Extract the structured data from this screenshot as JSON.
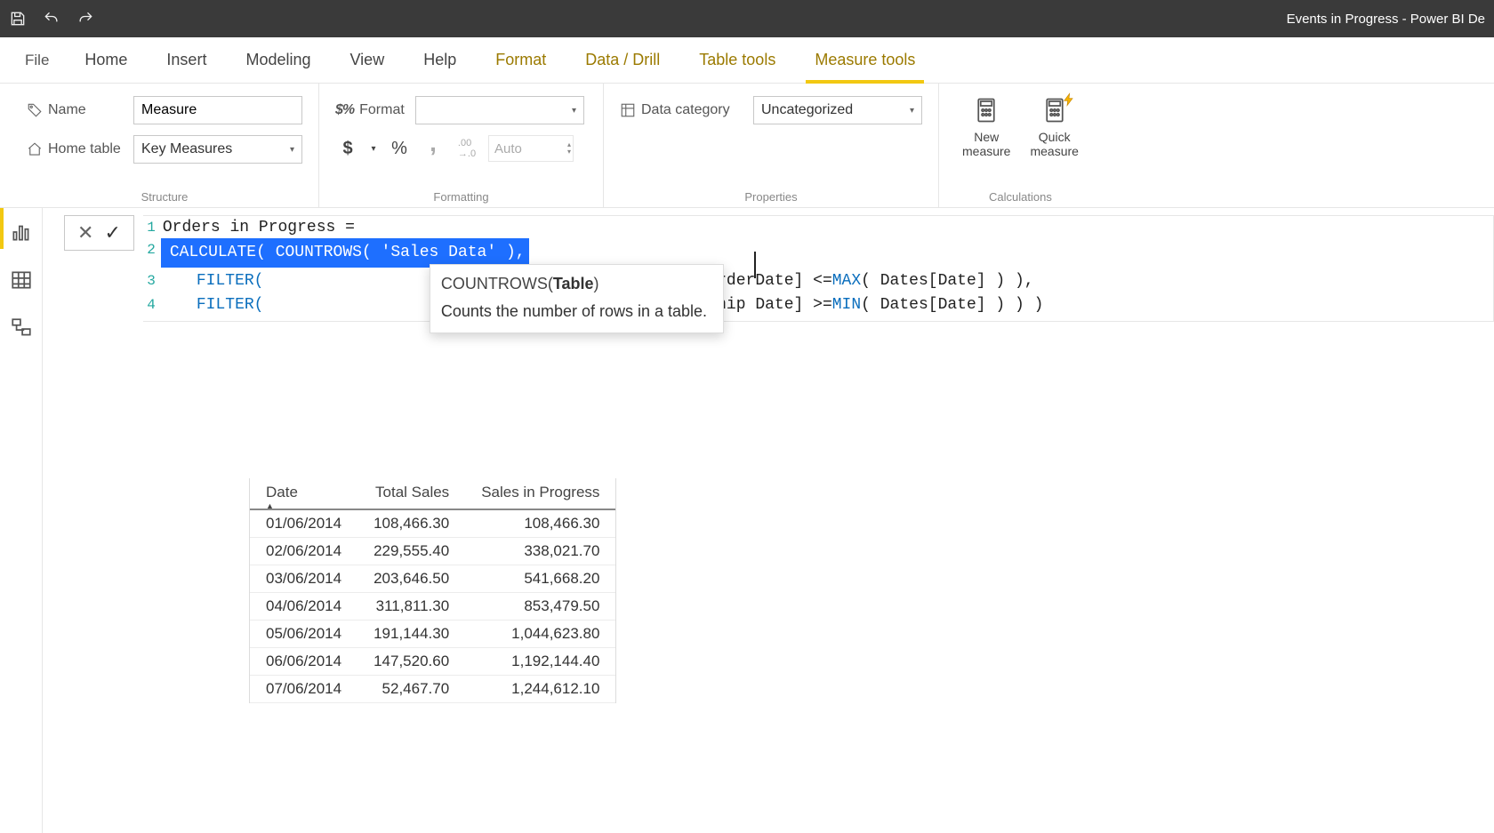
{
  "window": {
    "title": "Events in Progress - Power BI De"
  },
  "ribbon_tabs": {
    "file": "File",
    "tabs": [
      "Home",
      "Insert",
      "Modeling",
      "View",
      "Help",
      "Format",
      "Data / Drill",
      "Table tools",
      "Measure tools"
    ],
    "contextual_from_index": 5,
    "active_index": 8
  },
  "structure_group": {
    "title": "Structure",
    "name_label": "Name",
    "name_value": "Measure",
    "home_table_label": "Home table",
    "home_table_value": "Key Measures"
  },
  "formatting_group": {
    "title": "Formatting",
    "format_label": "Format",
    "format_value": "",
    "currency_button": "$",
    "percent_button": "%",
    "thousands_button": ",",
    "decimals_button": ".00→.0",
    "decimals_value": "Auto"
  },
  "properties_group": {
    "title": "Properties",
    "data_category_label": "Data category",
    "data_category_value": "Uncategorized"
  },
  "calculations_group": {
    "title": "Calculations",
    "new_measure": "New\nmeasure",
    "quick_measure": "Quick\nmeasure"
  },
  "formula": {
    "cancel": "✕",
    "commit": "✓",
    "line1": "Orders in Progress =",
    "line2_sel_prefix": "CALCULATE( COUNTROWS( ",
    "line2_sel_mid": "'Sales Data'",
    "line2_sel_suffix": " ),",
    "line3_kw": "FILTER(",
    "line3_rest_a": "ales Data'[OrderDate] <= ",
    "line3_fn": "MAX",
    "line3_rest_b": "( Dates[Date] ) ),",
    "line4_kw": "FILTER(",
    "line4_rest_a": "ales Data'[Ship Date] >= ",
    "line4_fn": "MIN",
    "line4_rest_b": "( Dates[Date] ) ) )",
    "line_numbers": [
      "1",
      "2",
      "3",
      "4"
    ]
  },
  "intellisense": {
    "signature_fn": "COUNTROWS(",
    "signature_arg": "Table",
    "signature_close": ")",
    "description": "Counts the number of rows in a table."
  },
  "table_visual": {
    "columns": [
      "Date",
      "Total Sales",
      "Sales in Progress"
    ],
    "rows": [
      [
        "01/06/2014",
        "108,466.30",
        "108,466.30"
      ],
      [
        "02/06/2014",
        "229,555.40",
        "338,021.70"
      ],
      [
        "03/06/2014",
        "203,646.50",
        "541,668.20"
      ],
      [
        "04/06/2014",
        "311,811.30",
        "853,479.50"
      ],
      [
        "05/06/2014",
        "191,144.30",
        "1,044,623.80"
      ],
      [
        "06/06/2014",
        "147,520.60",
        "1,192,144.40"
      ],
      [
        "07/06/2014",
        "52,467.70",
        "1,244,612.10"
      ]
    ]
  }
}
